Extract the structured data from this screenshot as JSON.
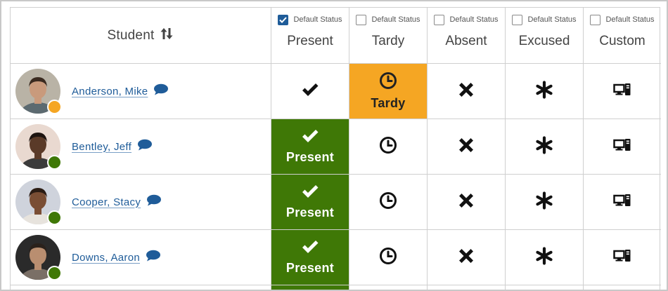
{
  "header": {
    "student_label": "Student",
    "default_status_label": "Default Status",
    "columns": [
      {
        "key": "present",
        "label": "Present",
        "default_checked": true
      },
      {
        "key": "tardy",
        "label": "Tardy",
        "default_checked": false
      },
      {
        "key": "absent",
        "label": "Absent",
        "default_checked": false
      },
      {
        "key": "excused",
        "label": "Excused",
        "default_checked": false
      },
      {
        "key": "custom",
        "label": "Custom",
        "default_checked": false
      }
    ]
  },
  "students": [
    {
      "name": "Anderson, Mike",
      "status_dot_color": "#f5a623",
      "selected": "tardy",
      "selected_label": "Tardy",
      "photo_bg": "#b9b3a6",
      "skin": "#c99a7c",
      "hair": "#3a2a20",
      "shirt": "#5c6a70"
    },
    {
      "name": "Bentley, Jeff",
      "status_dot_color": "#3f7806",
      "selected": "present",
      "selected_label": "Present",
      "photo_bg": "#e9d9d0",
      "skin": "#5a3a28",
      "hair": "#1d1410",
      "shirt": "#3b3b3b"
    },
    {
      "name": "Cooper, Stacy",
      "status_dot_color": "#3f7806",
      "selected": "present",
      "selected_label": "Present",
      "photo_bg": "#cfd3dc",
      "skin": "#7a4e34",
      "hair": "#2b1c14",
      "shirt": "#e7e3dd"
    },
    {
      "name": "Downs, Aaron",
      "status_dot_color": "#3f7806",
      "selected": "present",
      "selected_label": "Present",
      "photo_bg": "#2a2a2a",
      "skin": "#b98e70",
      "hair": "#2a211b",
      "shirt": "#7a6f66"
    }
  ],
  "colors": {
    "present": "#3f7806",
    "tardy": "#f5a623",
    "link": "#1f5c99"
  },
  "icons": {
    "present": "checkmark-icon",
    "tardy": "clock-icon",
    "absent": "x-icon",
    "excused": "asterisk-icon",
    "custom": "computer-icon",
    "sort": "sort-arrows-icon",
    "comment": "comment-bubble-icon"
  }
}
